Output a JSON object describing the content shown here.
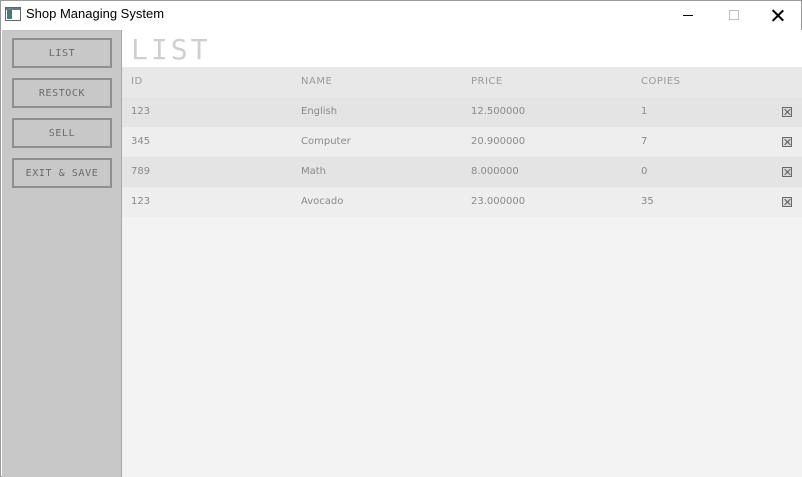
{
  "window": {
    "title": "Shop Managing System",
    "icon": "app-window-icon",
    "controls": [
      "minimize-icon",
      "maximize-icon",
      "close-icon"
    ]
  },
  "sidebar": {
    "buttons": [
      {
        "label": "LIST"
      },
      {
        "label": "RESTOCK"
      },
      {
        "label": "SELL"
      },
      {
        "label": "EXIT & SAVE"
      }
    ]
  },
  "main": {
    "heading": "LIST",
    "table": {
      "columns": [
        "ID",
        "NAME",
        "PRICE",
        "COPIES"
      ],
      "rows": [
        {
          "id": "123",
          "name": "English",
          "price": "12.500000",
          "copies": "1"
        },
        {
          "id": "345",
          "name": "Computer",
          "price": "20.900000",
          "copies": "7"
        },
        {
          "id": "789",
          "name": "Math",
          "price": "8.000000",
          "copies": "0"
        },
        {
          "id": "123",
          "name": "Avocado",
          "price": "23.000000",
          "copies": "35"
        }
      ],
      "row_action_icon": "delete-icon"
    }
  },
  "colors": {
    "sidebar_bg": "#c8c8c8",
    "main_bg": "#f3f3f3",
    "row_alt_1": "#e4e4e4",
    "row_alt_2": "#eeeeee",
    "text": "#8a8a8a"
  }
}
